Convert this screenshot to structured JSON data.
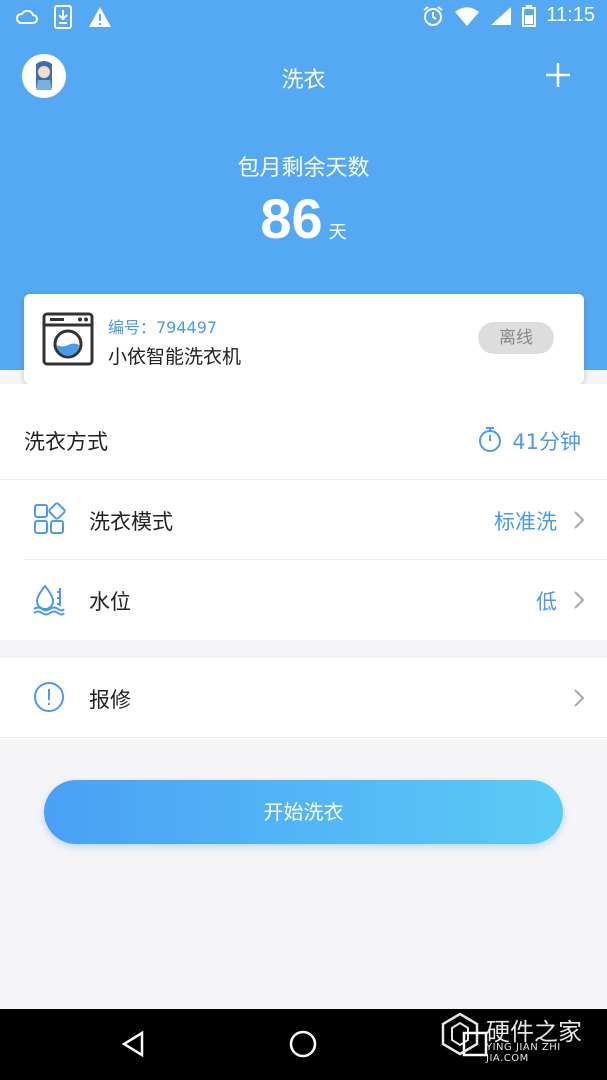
{
  "status_bar": {
    "time": "11:15"
  },
  "header": {
    "title": "洗衣"
  },
  "subscription": {
    "label": "包月剩余天数",
    "days": "86",
    "unit": "天"
  },
  "device": {
    "id_label": "编号：794497",
    "name": "小依智能洗衣机",
    "status": "离线"
  },
  "wash": {
    "method_label": "洗衣方式",
    "duration": "41分钟",
    "mode_label": "洗衣模式",
    "mode_value": "标准洗",
    "water_label": "水位",
    "water_value": "低",
    "repair_label": "报修"
  },
  "start_button": "开始洗衣",
  "watermark": {
    "title": "硬件之家",
    "subtitle": "YING JIAN ZHI JIA.COM"
  },
  "colors": {
    "primary": "#55a9f3",
    "accent": "#4a9be8",
    "background": "#f5f5f7"
  }
}
